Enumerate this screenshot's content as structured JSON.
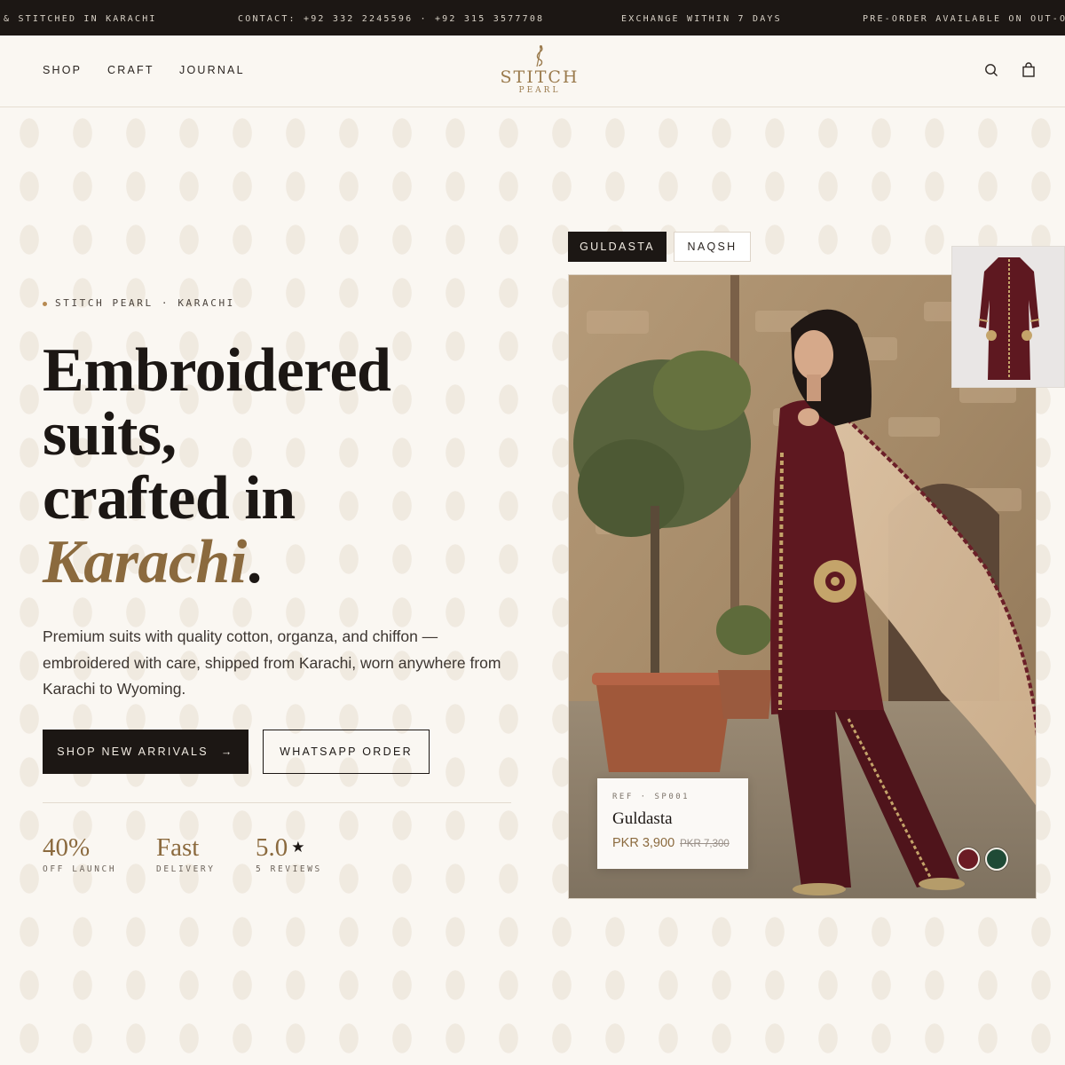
{
  "announcement": {
    "items": [
      "& STITCHED IN KARACHI",
      "CONTACT: +92 332 2245596 · +92 315 3577708",
      "EXCHANGE WITHIN 7 DAYS",
      "PRE-ORDER AVAILABLE ON OUT-OF"
    ]
  },
  "header": {
    "nav": [
      "SHOP",
      "CRAFT",
      "JOURNAL"
    ],
    "logo_word": "STITCH",
    "logo_sub": "PEARL",
    "icons": [
      "search-icon",
      "shopping-bag-icon"
    ]
  },
  "hero": {
    "eyebrow": "STITCH PEARL · KARACHI",
    "headline_line1": "Embroidered",
    "headline_line2": "suits,",
    "headline_line3": "crafted in",
    "headline_accent": "Karachi",
    "headline_end": ".",
    "lede": "Premium suits with quality cotton, organza, and chiffon — embroidered with care, shipped from Karachi, worn anywhere from Karachi to Wyoming.",
    "primary_cta": "SHOP NEW ARRIVALS",
    "primary_cta_arrow": "→",
    "secondary_cta": "WHATSAPP ORDER",
    "stats": [
      {
        "value": "40%",
        "label": "OFF LAUNCH"
      },
      {
        "value": "Fast",
        "label": "DELIVERY"
      },
      {
        "value": "5.0",
        "star": "★",
        "label": "5 REVIEWS"
      }
    ]
  },
  "product": {
    "tabs": [
      "GULDASTA",
      "NAQSH"
    ],
    "active_tab": "GULDASTA",
    "ref": "REF · SP001",
    "name": "Guldasta",
    "price": "PKR 3,900",
    "old_price": "PKR 7,300",
    "swatches": [
      "#6b1b24",
      "#1f4a36"
    ]
  },
  "colors": {
    "accent_gold": "#8b6a3e",
    "dark": "#1c1714",
    "background": "#faf7f2",
    "maroon": "#5e1820"
  }
}
